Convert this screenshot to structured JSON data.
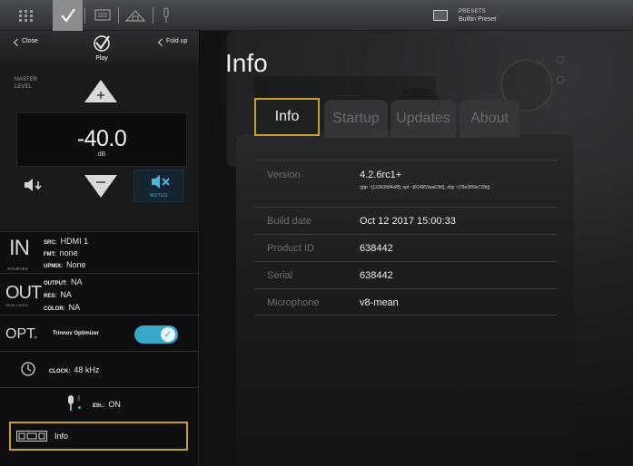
{
  "topbar": {
    "icons": [
      "grid-icon",
      "checkmark-icon",
      "screen-icon",
      "speaker-icon",
      "microphone-icon"
    ],
    "preset_label": "PRESETS",
    "preset_value": "Builtin Preset"
  },
  "sidebar": {
    "close_label": "Close",
    "fold_up_label": "Fold up",
    "logo_text": "Play",
    "master_level_label": "MASTER LEVEL",
    "volume_value": "-40.0",
    "volume_unit": "dB",
    "muted_label": "MUTED",
    "input": {
      "title": "IN",
      "caption": "SOURCES",
      "src_key": "SRC:",
      "src_value": "HDMI 1",
      "fmt_key": "FMT:",
      "fmt_value": "none",
      "upmix_key": "UPMIX:",
      "upmix_value": "None"
    },
    "output": {
      "title": "OUT",
      "caption": "HDMI VIDEO",
      "output_key": "OUTPUT:",
      "output_value": "NA",
      "res_key": "RES:",
      "res_value": "NA",
      "color_key": "COLOR:",
      "color_value": "NA"
    },
    "optimizer": {
      "title": "OPT.",
      "name": "Trinnov Optimizer",
      "enabled": true
    },
    "clock": {
      "key": "CLOCK:",
      "value": "48 kHz"
    },
    "ethernet": {
      "mic_status": "ON",
      "key": "Eth.:",
      "value": "ON"
    },
    "info_item_label": "Info"
  },
  "main": {
    "title": "Info",
    "tabs": [
      {
        "label": "Info",
        "active": true
      },
      {
        "label": "Startup",
        "active": false
      },
      {
        "label": "Updates",
        "active": false
      },
      {
        "label": "About",
        "active": false
      }
    ],
    "info": {
      "version_label": "Version",
      "version_value": "4.2.6rc1+",
      "version_detail": "(gtp ~[12363fbf4c8f], opt ~[814959aa63fd], dsp ~[78e3f09e72fb])",
      "build_date_label": "Build date",
      "build_date_value": "Oct 12 2017 15:00:33",
      "product_id_label": "Product ID",
      "product_id_value": "638442",
      "serial_label": "Serial",
      "serial_value": "638442",
      "microphone_label": "Microphone",
      "microphone_value": "v8-mean"
    }
  },
  "colors": {
    "highlight": "#c6a12b",
    "accent": "#37a8c8",
    "muted_text": "#4ab6d9"
  }
}
